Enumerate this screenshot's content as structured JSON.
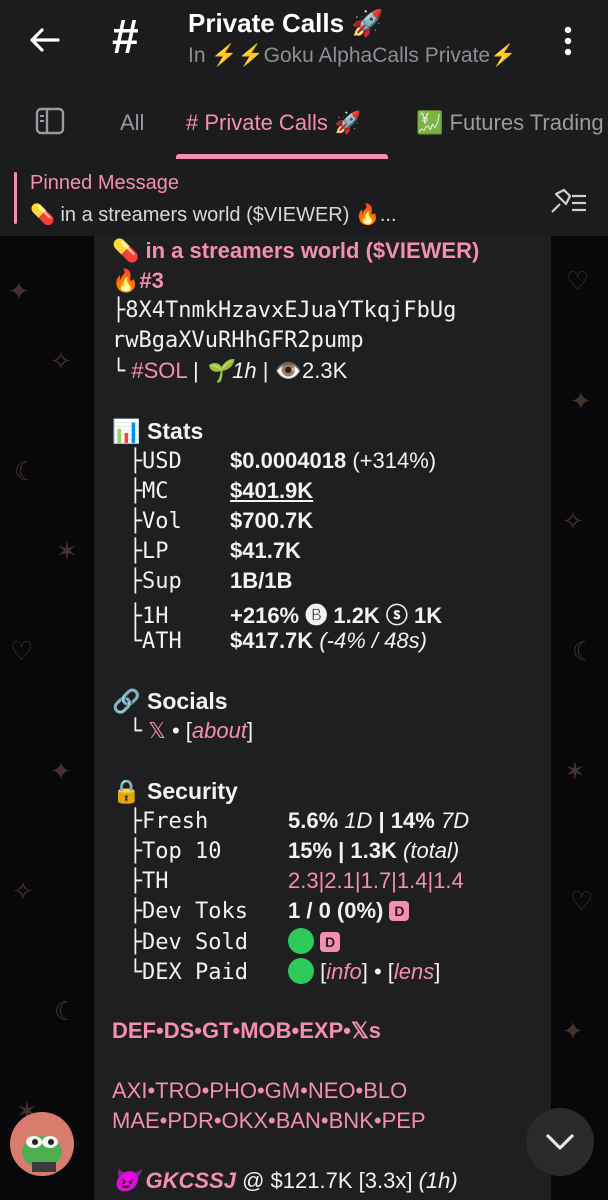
{
  "header": {
    "title": "Private Calls 🚀",
    "subtitle": "In ⚡⚡Goku AlphaCalls Private⚡"
  },
  "tabs": [
    {
      "label": "All"
    },
    {
      "label": "# Private Calls 🚀"
    },
    {
      "label": "💹 Futures Trading"
    }
  ],
  "pinned": {
    "title": "Pinned Message",
    "text": "💊 in a streamers world ($VIEWER) 🔥..."
  },
  "message": {
    "token_name": "💊 in a streamers world",
    "token_ticker": "($VIEWER)",
    "rank": "🔥#3",
    "address_line1": "8X4TnmkHzavxEJuaYTkqjFbUg",
    "address_line2": "rwBgaXVuRHhGFR2pump",
    "chain": "#SOL",
    "age": "🌱1h",
    "views": "👁️2.3K",
    "stats": {
      "heading": "📊 Stats",
      "rows": [
        {
          "key": "USD",
          "value": "$0.0004018",
          "extra": "(+314%)"
        },
        {
          "key": "MC",
          "value": "$401.9K",
          "extra": ""
        },
        {
          "key": "Vol",
          "value": "$700.7K",
          "extra": ""
        },
        {
          "key": "LP",
          "value": "$41.7K",
          "extra": ""
        },
        {
          "key": "Sup",
          "value": "1B/1B",
          "extra": ""
        },
        {
          "key": "1H",
          "value": "+216% 🅑 1.2K ⓢ 1K",
          "extra": ""
        },
        {
          "key": "ATH",
          "value": "$417.7K",
          "extra": "(-4% / 48s)"
        }
      ]
    },
    "socials": {
      "heading": "🔗 Socials",
      "x": "𝕏",
      "sep": "•",
      "about": "about"
    },
    "security": {
      "heading": "🔒 Security",
      "fresh_key": "Fresh",
      "fresh_value": "5.6%",
      "fresh_1d": "1D",
      "fresh_value2": "| 14%",
      "fresh_7d": "7D",
      "top10_key": "Top 10",
      "top10_value": "15% | 1.3K",
      "top10_total": "(total)",
      "th_key": "TH",
      "th_value": "2.3|2.1|1.7|1.4|1.4",
      "devtoks_key": "Dev Toks",
      "devtoks_value": "1 / 0 (0%)",
      "devsold_key": "Dev Sold",
      "dexpaid_key": "DEX Paid",
      "info": "info",
      "lens": "lens",
      "badge": "D"
    },
    "links1": "DEF•DS•GT•MOB•EXP•𝕏s",
    "links2": "AXI•TRO•PHO•GM•NEO•BLO",
    "links3": "MAE•PDR•OKX•BAN•BNK•PEP",
    "caller_name": "😈 GKCSSJ",
    "caller_at": "@ $121.7K [3.3x]",
    "caller_time": "(1h)"
  },
  "colors": {
    "accent": "#f48fb1",
    "header_bg": "#1c1c1e",
    "bubble_bg": "#1f1f21",
    "green": "#2ec95b"
  }
}
